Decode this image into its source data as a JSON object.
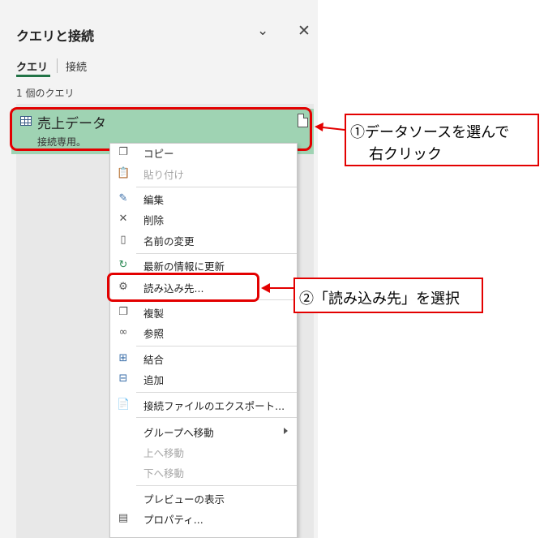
{
  "pane": {
    "title": "クエリと接続",
    "tabs": [
      "クエリ",
      "接続"
    ],
    "count_label": "1 個のクエリ"
  },
  "query": {
    "name": "売上データ",
    "status": "接続専用。"
  },
  "menu": {
    "items": [
      {
        "label": "コピー",
        "icon": "copy-icon",
        "enabled": true
      },
      {
        "label": "貼り付け",
        "icon": "paste-icon",
        "enabled": false
      },
      {
        "label": "編集",
        "icon": "edit-icon",
        "enabled": true
      },
      {
        "label": "削除",
        "icon": "delete-icon",
        "enabled": true
      },
      {
        "label": "名前の変更",
        "icon": "rename-icon",
        "enabled": true
      },
      {
        "label": "最新の情報に更新",
        "icon": "refresh-icon",
        "enabled": true
      },
      {
        "label": "読み込み先...",
        "icon": "load-to-icon",
        "enabled": true
      },
      {
        "label": "複製",
        "icon": "duplicate-icon",
        "enabled": true
      },
      {
        "label": "参照",
        "icon": "reference-icon",
        "enabled": true
      },
      {
        "label": "結合",
        "icon": "merge-icon",
        "enabled": true
      },
      {
        "label": "追加",
        "icon": "append-icon",
        "enabled": true
      },
      {
        "label": "接続ファイルのエクスポート...",
        "icon": "export-icon",
        "enabled": true
      },
      {
        "label": "グループへ移動",
        "icon": "",
        "enabled": true,
        "submenu": true
      },
      {
        "label": "上へ移動",
        "icon": "",
        "enabled": false
      },
      {
        "label": "下へ移動",
        "icon": "",
        "enabled": false
      },
      {
        "label": "プレビューの表示",
        "icon": "",
        "enabled": true
      },
      {
        "label": "プロパティ...",
        "icon": "properties-icon",
        "enabled": true
      }
    ]
  },
  "callouts": {
    "step1_line1": "①データソースを選んで",
    "step1_line2": "右クリック",
    "step2": "②「読み込み先」を選択"
  },
  "colors": {
    "highlight_red": "#e30000",
    "selected_green": "#9fd3b3",
    "tab_accent": "#217346"
  }
}
